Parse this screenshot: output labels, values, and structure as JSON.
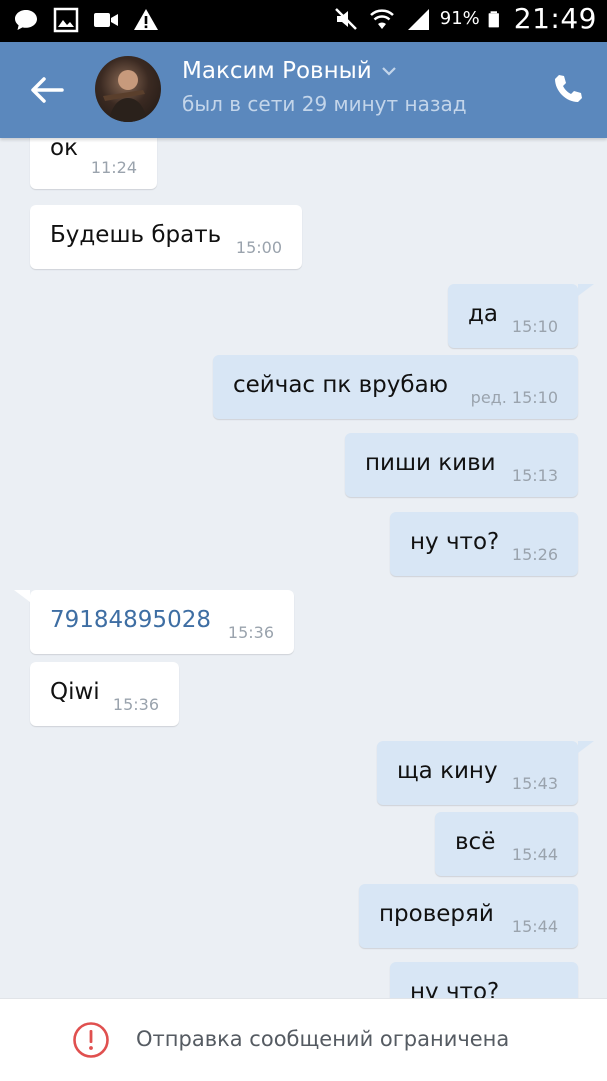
{
  "status_bar": {
    "battery_percent": "91%",
    "time": "21:49",
    "left_icons": [
      "chat-icon",
      "image-icon",
      "video-icon",
      "warning-icon"
    ],
    "right_icons": [
      "mute-icon",
      "wifi-icon",
      "signal-icon",
      "battery-icon"
    ]
  },
  "header": {
    "contact_name": "Максим Ровный",
    "status": "был в сети 29 минут назад",
    "colors": {
      "background": "#5b88bd",
      "status_text": "#c3d5ea"
    }
  },
  "messages": [
    {
      "dir": "in",
      "text": "ок",
      "time": "11:24"
    },
    {
      "dir": "in",
      "text": "Будешь брать",
      "time": "15:00"
    },
    {
      "dir": "out",
      "text": "да",
      "time": "15:10"
    },
    {
      "dir": "out",
      "text": "сейчас пк врубаю",
      "time": "ред. 15:10"
    },
    {
      "dir": "out",
      "text": "пиши киви",
      "time": "15:13"
    },
    {
      "dir": "out",
      "text": "ну что?",
      "time": "15:26"
    },
    {
      "dir": "in",
      "text": "79184895028",
      "time": "15:36",
      "link": true
    },
    {
      "dir": "in",
      "text": "Qiwi",
      "time": "15:36"
    },
    {
      "dir": "out",
      "text": "ща кину",
      "time": "15:43"
    },
    {
      "dir": "out",
      "text": "всё",
      "time": "15:44"
    },
    {
      "dir": "out",
      "text": "проверяй",
      "time": "15:44"
    },
    {
      "dir": "out",
      "text": "ну что?",
      "time": ""
    }
  ],
  "bottom_bar": {
    "notice": "Отправка сообщений ограничена",
    "icon": "exclamation-circle-icon",
    "icon_color": "#e0504f"
  },
  "colors": {
    "chat_background": "#ebeff4",
    "incoming_bubble": "#ffffff",
    "outgoing_bubble": "#d8e6f5",
    "link": "#3e6ea3"
  }
}
